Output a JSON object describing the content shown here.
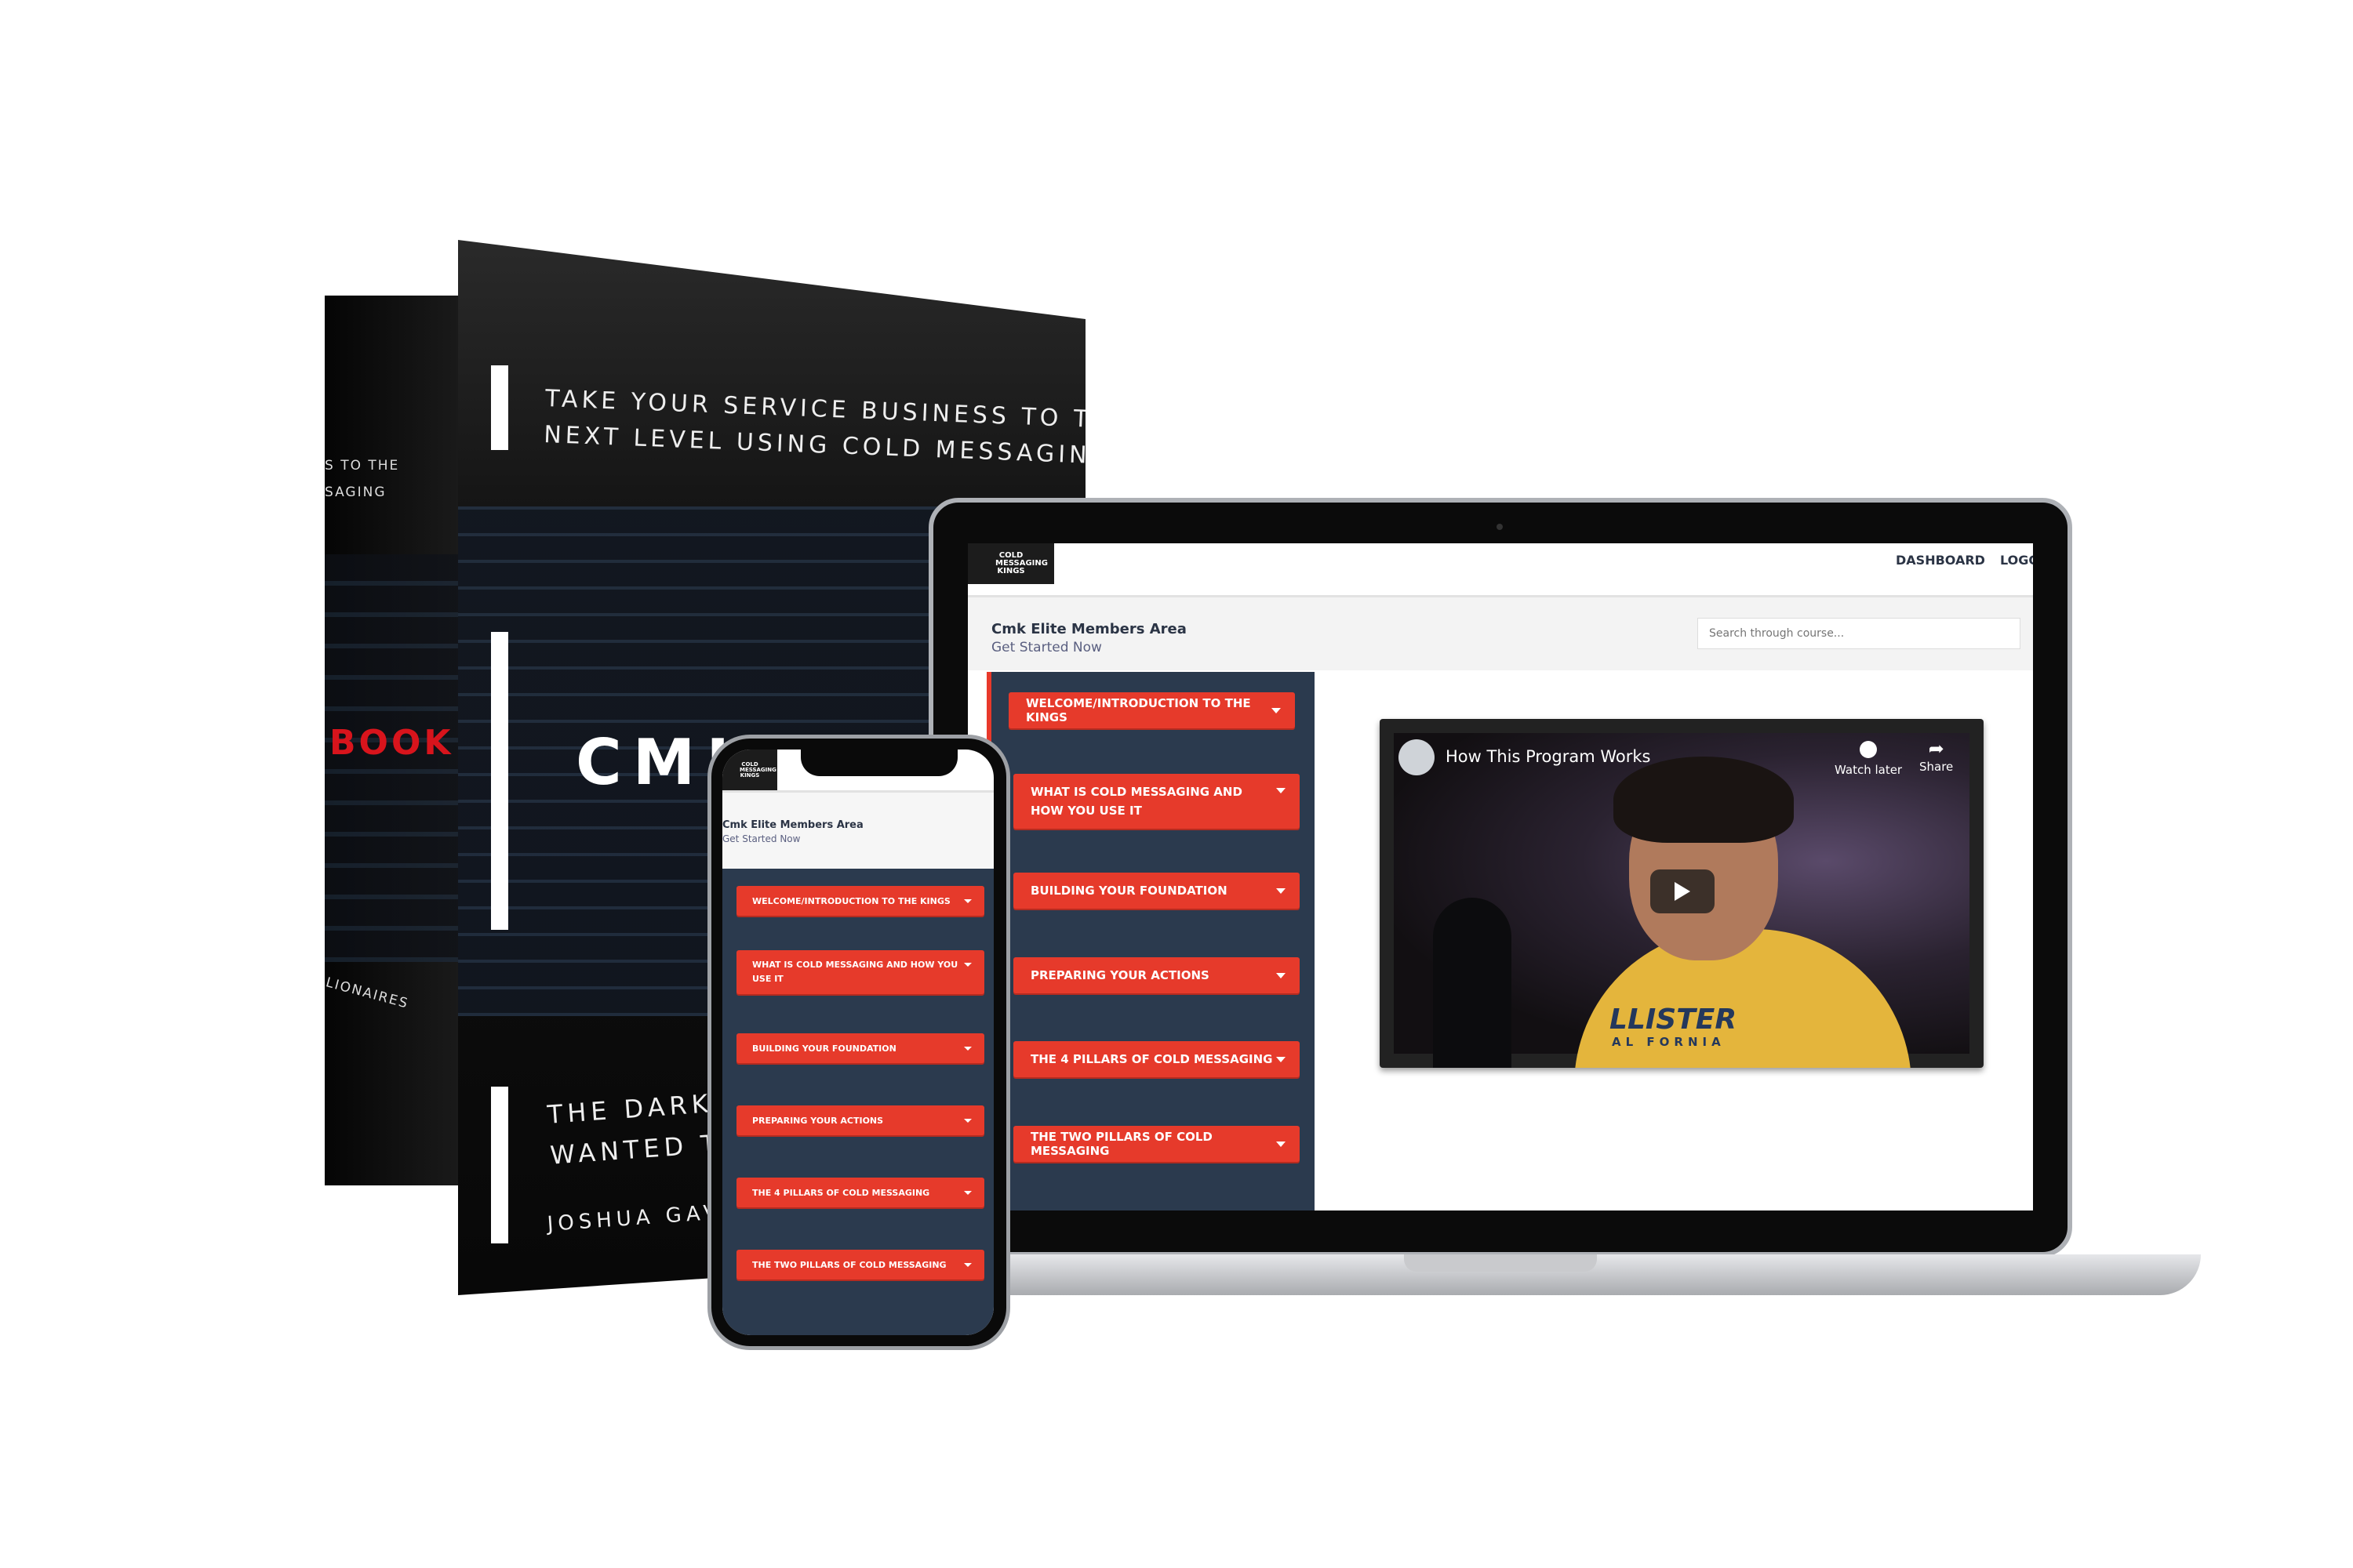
{
  "box": {
    "top_text": [
      "TAKE YOUR SERVICE BUSINESS TO THE",
      "NEXT LEVEL USING COLD MESSAGING"
    ],
    "side_top": [
      "S TO THE",
      "SAGING"
    ],
    "side_book": "BOOK",
    "side_bottom": "LIONAIRES",
    "brand": "CMK",
    "bottom_text": [
      "THE DARK SEC",
      "WANTED TO KE"
    ],
    "author": "JOSHUA GAVIN",
    "accent": "#d8141c"
  },
  "site": {
    "logo": "COLD MESSAGING KINGS",
    "nav": {
      "dashboard": "DASHBOARD",
      "logout": "LOGO"
    },
    "title": "Cmk Elite Members Area",
    "subtitle": "Get Started Now",
    "search_placeholder": "Search through course...",
    "modules": [
      "WELCOME/INTRODUCTION TO THE KINGS",
      "WHAT IS COLD MESSAGING AND HOW YOU USE IT",
      "BUILDING YOUR FOUNDATION",
      "PREPARING YOUR ACTIONS",
      "THE 4 PILLARS OF COLD MESSAGING",
      "THE TWO PILLARS OF COLD MESSAGING"
    ],
    "video": {
      "title": "How This Program Works",
      "watch_later": "Watch later",
      "share": "Share",
      "shirt_text": "LLISTER",
      "shirt_sub": "AL FORNIA"
    },
    "colors": {
      "accent": "#e63a2b",
      "sidebar": "#2b3a4e"
    }
  }
}
